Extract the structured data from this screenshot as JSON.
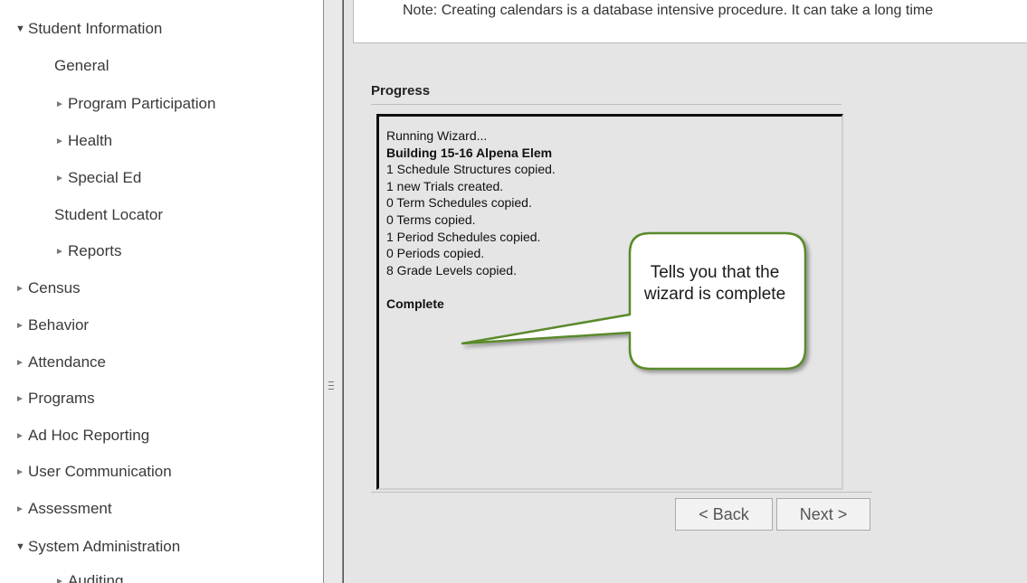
{
  "sidebar": {
    "items": [
      {
        "label": "Student Information",
        "arrow": "▼"
      },
      {
        "label": "General",
        "arrow": ""
      },
      {
        "label": "Program Participation",
        "arrow": "►"
      },
      {
        "label": "Health",
        "arrow": "►"
      },
      {
        "label": "Special Ed",
        "arrow": "►"
      },
      {
        "label": "Student Locator",
        "arrow": ""
      },
      {
        "label": "Reports",
        "arrow": "►"
      },
      {
        "label": "Census",
        "arrow": "►"
      },
      {
        "label": "Behavior",
        "arrow": "►"
      },
      {
        "label": "Attendance",
        "arrow": "►"
      },
      {
        "label": "Programs",
        "arrow": "►"
      },
      {
        "label": "Ad Hoc Reporting",
        "arrow": "►"
      },
      {
        "label": "User Communication",
        "arrow": "►"
      },
      {
        "label": "Assessment",
        "arrow": "►"
      },
      {
        "label": "System Administration",
        "arrow": "▼"
      },
      {
        "label": "Auditing",
        "arrow": "►"
      }
    ]
  },
  "main": {
    "note": "Note: Creating calendars is a database intensive procedure. It can take a long time",
    "progress_title": "Progress",
    "log": [
      {
        "text": "Running Wizard...",
        "bold": false
      },
      {
        "text": "Building 15-16 Alpena Elem",
        "bold": true
      },
      {
        "text": "1 Schedule Structures copied.",
        "bold": false
      },
      {
        "text": "1 new Trials created.",
        "bold": false
      },
      {
        "text": "0 Term Schedules copied.",
        "bold": false
      },
      {
        "text": "0 Terms copied.",
        "bold": false
      },
      {
        "text": "1 Period Schedules copied.",
        "bold": false
      },
      {
        "text": "0 Periods copied.",
        "bold": false
      },
      {
        "text": "8 Grade Levels copied.",
        "bold": false
      },
      {
        "text": "",
        "bold": false
      },
      {
        "text": "Complete",
        "bold": true
      }
    ],
    "back_label": "< Back",
    "next_label": "Next >"
  },
  "callout": {
    "text": "Tells you that the wizard is complete",
    "border_color": "#5a8a2c"
  }
}
